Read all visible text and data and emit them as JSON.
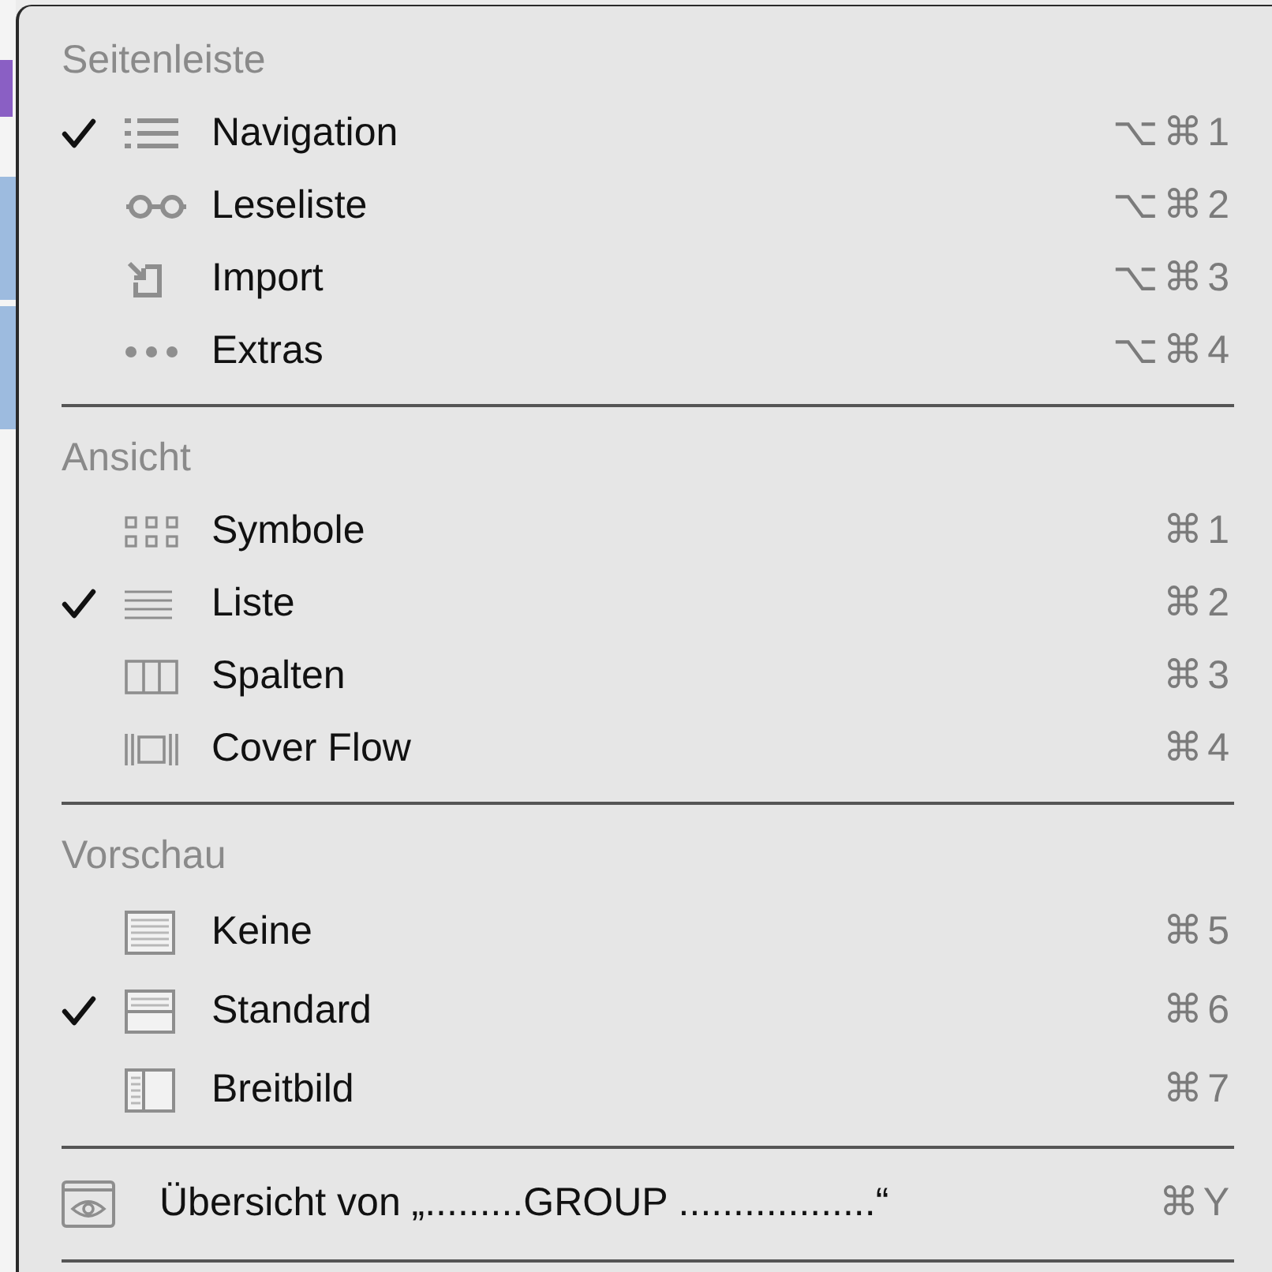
{
  "sections": [
    {
      "header": "Seitenleiste",
      "items": [
        {
          "label": "Navigation",
          "shortcut": "⌥⌘1",
          "checked": true,
          "kind": "list"
        },
        {
          "label": "Leseliste",
          "shortcut": "⌥⌘2",
          "checked": false,
          "kind": "glasses"
        },
        {
          "label": "Import",
          "shortcut": "⌥⌘3",
          "checked": false,
          "kind": "import"
        },
        {
          "label": "Extras",
          "shortcut": "⌥⌘4",
          "checked": false,
          "kind": "dots"
        }
      ]
    },
    {
      "header": "Ansicht",
      "items": [
        {
          "label": "Symbole",
          "shortcut": "⌘1",
          "checked": false,
          "kind": "grid"
        },
        {
          "label": "Liste",
          "shortcut": "⌘2",
          "checked": true,
          "kind": "lines"
        },
        {
          "label": "Spalten",
          "shortcut": "⌘3",
          "checked": false,
          "kind": "columns"
        },
        {
          "label": "Cover Flow",
          "shortcut": "⌘4",
          "checked": false,
          "kind": "coverflow"
        }
      ]
    },
    {
      "header": "Vorschau",
      "items": [
        {
          "label": "Keine",
          "shortcut": "⌘5",
          "checked": false,
          "kind": "pnone"
        },
        {
          "label": "Standard",
          "shortcut": "⌘6",
          "checked": true,
          "kind": "pstandard"
        },
        {
          "label": "Breitbild",
          "shortcut": "⌘7",
          "checked": false,
          "kind": "pwide"
        }
      ]
    }
  ],
  "footer_item": {
    "label": "Übersicht von „.........GROUP ..................“",
    "shortcut": "⌘Y",
    "kind": "eye"
  }
}
